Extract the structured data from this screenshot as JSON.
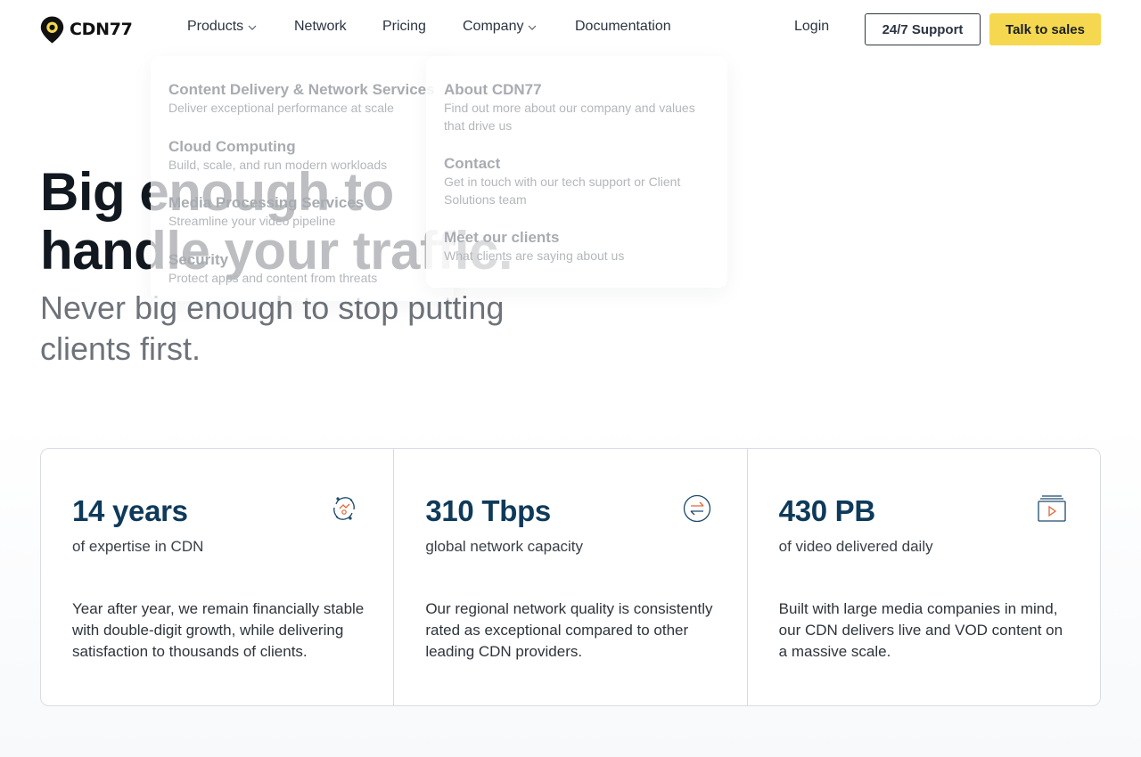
{
  "brand": {
    "name": "CDN77"
  },
  "nav": {
    "products": "Products",
    "network": "Network",
    "pricing": "Pricing",
    "company": "Company",
    "documentation": "Documentation"
  },
  "header_actions": {
    "login": "Login",
    "support": "24/7 Support",
    "sales": "Talk to sales"
  },
  "hero": {
    "title_line1": "Big enough to",
    "title_line2": "handle your traffic.",
    "subtitle_line1": "Never big enough to stop putting",
    "subtitle_line2": "clients first."
  },
  "products_menu": [
    {
      "title": "Content Delivery & Network Services",
      "desc": "Deliver exceptional performance at scale"
    },
    {
      "title": "Cloud Computing",
      "desc": "Build, scale, and run modern workloads"
    },
    {
      "title": "Media Processing Services",
      "desc": "Streamline your video pipeline"
    },
    {
      "title": "Security",
      "desc": "Protect apps and content from threats"
    }
  ],
  "company_menu": [
    {
      "title": "About CDN77",
      "desc": "Find out more about our company and values that drive us"
    },
    {
      "title": "Contact",
      "desc": "Get in touch with our tech support or Client Solutions team"
    },
    {
      "title": "Meet our clients",
      "desc": "What clients are saying about us"
    }
  ],
  "stats": [
    {
      "value": "14 years",
      "label": "of expertise in CDN",
      "desc": "Year after year, we remain financially stable with double-digit growth, while delivering satisfaction to thousands of clients.",
      "icon": "growth-cycle-icon"
    },
    {
      "value": "310 Tbps",
      "label": "global network capacity",
      "desc": "Our regional network quality is consistently rated as exceptional compared to other leading CDN providers.",
      "icon": "exchange-arrows-icon"
    },
    {
      "value": "430 PB",
      "label": "of video delivered daily",
      "desc": "Built with large media companies in mind, our CDN delivers live and VOD content on a massive scale.",
      "icon": "video-stack-icon"
    }
  ],
  "colors": {
    "accent_yellow": "#f5d84f",
    "stat_value": "#0f3a5a",
    "icon_orange": "#e2673a",
    "icon_blue": "#1f4a6c"
  }
}
